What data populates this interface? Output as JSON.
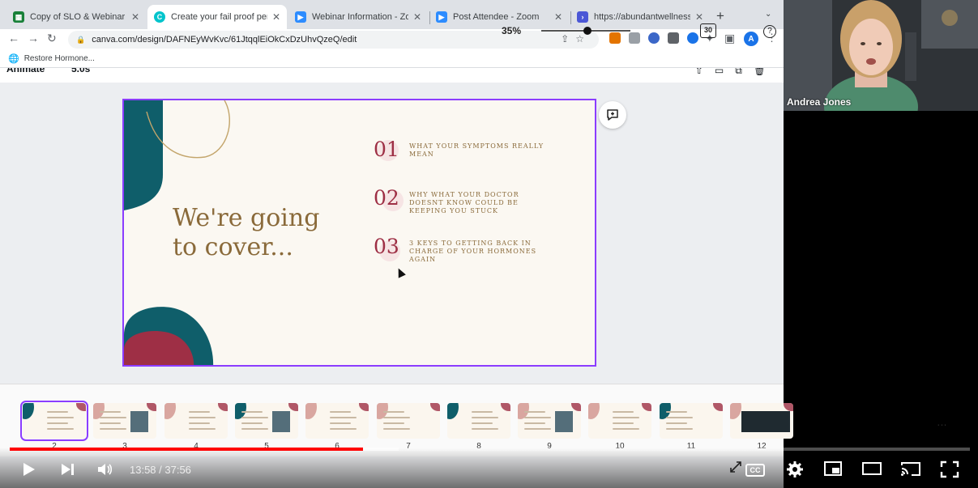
{
  "browser": {
    "tabs": [
      {
        "title": "Copy of SLO & Webinar Stats",
        "icon": "sheets-icon",
        "color": "#188038"
      },
      {
        "title": "Create your fail proof period",
        "icon": "canva-icon",
        "color": "#00c4cc"
      },
      {
        "title": "Webinar Information - Zoom",
        "icon": "zoom-icon",
        "color": "#2d8cff"
      },
      {
        "title": "Post Attendee - Zoom",
        "icon": "zoom-icon",
        "color": "#2d8cff"
      },
      {
        "title": "https://abundantwellnesswit",
        "icon": "link-icon",
        "color": "#4b57d6"
      }
    ],
    "url": "canva.com/design/DAFNEyWvKvc/61JtqqlEiOkCxDzUhvQzeQ/edit",
    "bookmark": "Restore Hormone...",
    "profile_initial": "A"
  },
  "editor": {
    "animate_label": "Animate",
    "timer_label": "5.0s",
    "slide": {
      "title": "We're going\nto cover...",
      "items": [
        {
          "num": "01",
          "text": "WHAT YOUR SYMPTOMS REALLY MEAN"
        },
        {
          "num": "02",
          "text": "WHY WHAT YOUR DOCTOR DOESNT KNOW COULD BE KEEPING YOU STUCK"
        },
        {
          "num": "03",
          "text": "3 KEYS TO GETTING BACK IN CHARGE OF YOUR HORMONES AGAIN"
        }
      ]
    },
    "thumbnails": [
      "2",
      "3",
      "4",
      "5",
      "6",
      "7",
      "8",
      "9",
      "10",
      "11",
      "12"
    ],
    "zoom": "35%",
    "page_count": "30",
    "help": "?"
  },
  "zoom_call": {
    "participant": "Andrea Jones"
  },
  "player": {
    "time": "13:58 / 37:56",
    "progress": 0.368,
    "buffered": 0.405,
    "cc_label": "CC"
  },
  "colors": {
    "accent": "#8b3dff",
    "teal": "#0f5e6a",
    "crimson": "#9e2f45",
    "gold": "#8a6a3a",
    "progress": "#ff0000"
  }
}
